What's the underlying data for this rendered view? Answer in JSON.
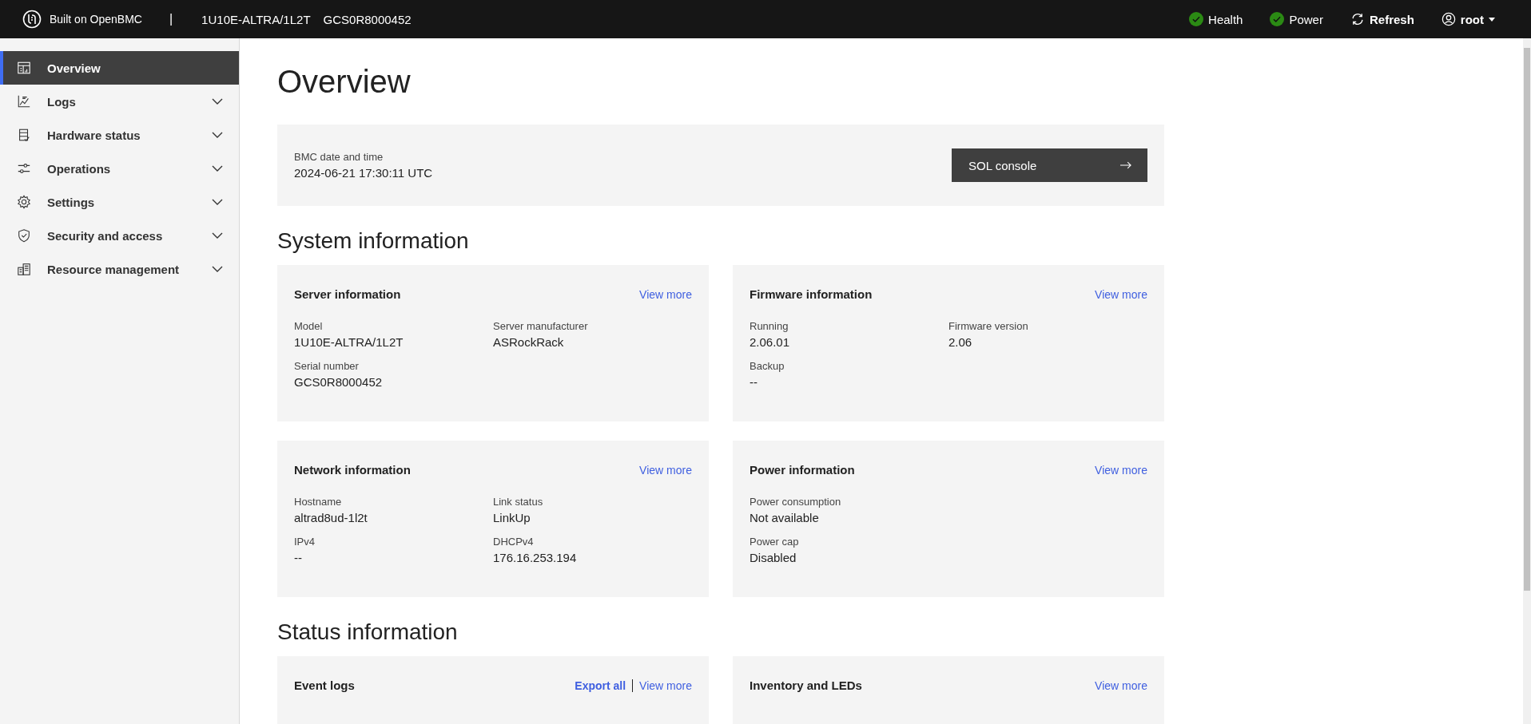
{
  "header": {
    "brand_prefix": "Built on",
    "brand_name": "OpenBMC",
    "separator": "|",
    "model": "1U10E-ALTRA/1L2T",
    "serial": "GCS0R8000452",
    "status_items": [
      {
        "label": "Health",
        "kind": "ok"
      },
      {
        "label": "Power",
        "kind": "ok"
      }
    ],
    "refresh": "Refresh",
    "user": "root"
  },
  "sidebar": {
    "items": [
      {
        "label": "Overview",
        "selected": true,
        "expandable": false
      },
      {
        "label": "Logs",
        "selected": false,
        "expandable": true
      },
      {
        "label": "Hardware status",
        "selected": false,
        "expandable": true
      },
      {
        "label": "Operations",
        "selected": false,
        "expandable": true
      },
      {
        "label": "Settings",
        "selected": false,
        "expandable": true
      },
      {
        "label": "Security and access",
        "selected": false,
        "expandable": true
      },
      {
        "label": "Resource management",
        "selected": false,
        "expandable": true
      }
    ]
  },
  "page_title": "Overview",
  "bmc_time": {
    "label": "BMC date and time",
    "value": "2024-06-21 17:30:11 UTC",
    "button": "SOL console"
  },
  "sections": [
    {
      "title": "System information",
      "cards": [
        {
          "title": "Server information",
          "links": [
            {
              "label": "View more",
              "kind": "plain"
            }
          ],
          "rows": [
            [
              {
                "label": "Model",
                "value": "1U10E-ALTRA/1L2T"
              },
              {
                "label": "Server manufacturer",
                "value": "ASRockRack"
              }
            ],
            [
              {
                "label": "Serial number",
                "value": "GCS0R8000452"
              }
            ]
          ]
        },
        {
          "title": "Firmware information",
          "links": [
            {
              "label": "View more",
              "kind": "plain"
            }
          ],
          "rows": [
            [
              {
                "label": "Running",
                "value": "2.06.01"
              },
              {
                "label": "Firmware version",
                "value": "2.06"
              }
            ],
            [
              {
                "label": "Backup",
                "value": "--"
              }
            ]
          ]
        },
        {
          "title": "Network information",
          "links": [
            {
              "label": "View more",
              "kind": "plain"
            }
          ],
          "rows": [
            [
              {
                "label": "Hostname",
                "value": "altrad8ud-1l2t"
              },
              {
                "label": "Link status",
                "value": "LinkUp"
              }
            ],
            [
              {
                "label": "IPv4",
                "value": "--"
              },
              {
                "label": "DHCPv4",
                "value": "176.16.253.194"
              }
            ]
          ]
        },
        {
          "title": "Power information",
          "links": [
            {
              "label": "View more",
              "kind": "plain"
            }
          ],
          "rows": [
            [
              {
                "label": "Power consumption",
                "value": "Not available"
              }
            ],
            [
              {
                "label": "Power cap",
                "value": "Disabled"
              }
            ]
          ]
        }
      ]
    },
    {
      "title": "Status information",
      "cards": [
        {
          "title": "Event logs",
          "links": [
            {
              "label": "Export all",
              "kind": "bold"
            },
            {
              "label": "View more",
              "kind": "plain"
            }
          ]
        },
        {
          "title": "Inventory and LEDs",
          "links": [
            {
              "label": "View more",
              "kind": "plain"
            }
          ]
        }
      ]
    }
  ]
}
